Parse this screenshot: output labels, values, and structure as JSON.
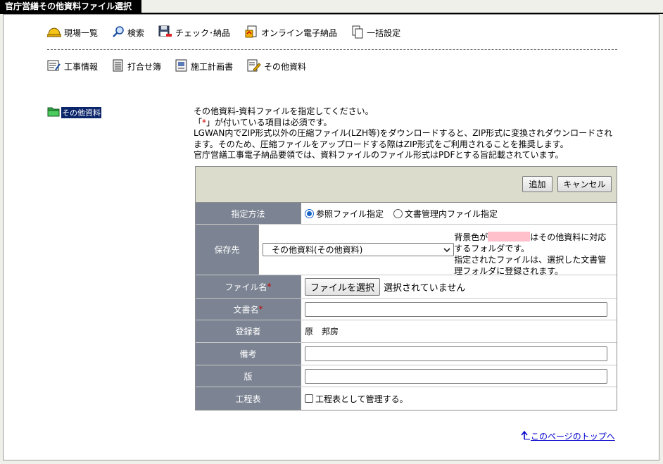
{
  "window": {
    "title": "官庁営繕その他資料ファイル選択"
  },
  "toolbar1": [
    {
      "label": "現場一覧",
      "icon": "hardhat-icon"
    },
    {
      "label": "検索",
      "icon": "magnifier-icon"
    },
    {
      "label": "チェック･納品",
      "icon": "floppy-disk-icon"
    },
    {
      "label": "オンライン電子納品",
      "icon": "online-delivery-icon"
    },
    {
      "label": "一括設定",
      "icon": "copy-pages-icon"
    }
  ],
  "toolbar2": [
    {
      "label": "工事情報",
      "icon": "construction-info-icon"
    },
    {
      "label": "打合せ簿",
      "icon": "meeting-record-icon"
    },
    {
      "label": "施工計画書",
      "icon": "construction-plan-icon"
    },
    {
      "label": "その他資料",
      "icon": "other-docs-icon"
    }
  ],
  "tree": {
    "selected_label": "その他資料"
  },
  "notes": {
    "line1": "その他資料-資料ファイルを指定してください。",
    "line2_pre": "「",
    "line2_star": "*",
    "line2_post": "」が付いている項目は必須です。",
    "line3": "LGWAN内でZIP形式以外の圧縮ファイル(LZH等)をダウンロードすると、ZIP形式に変換されダウンロードされます。そのため、圧縮ファイルをアップロードする際はZIP形式をご利用されることを推奨します。",
    "line4": "官庁営繕工事電子納品要領では、資料ファイルのファイル形式はPDFとする旨記載されています。"
  },
  "buttons": {
    "add": "追加",
    "cancel": "キャンセル"
  },
  "form": {
    "method": {
      "label": "指定方法",
      "option1": "参照ファイル指定",
      "option2": "文書管理内ファイル指定",
      "selected": "参照ファイル指定"
    },
    "destination": {
      "label": "保存先",
      "selected": "その他資料(その他資料)",
      "note_pre": "背景色が",
      "note_post": "はその他資料に対応するフォルダです。",
      "note2": "指定されたファイルは、選択した文書管理フォルダに登録されます。",
      "highlight_color": "#ffc0cb"
    },
    "file": {
      "label": "ファイル名",
      "star": "*",
      "button": "ファイルを選択",
      "status": "選択されていません"
    },
    "doc_name": {
      "label": "文書名",
      "star": "*",
      "value": ""
    },
    "registrant": {
      "label": "登録者",
      "value": "原　邦房"
    },
    "remarks": {
      "label": "備考",
      "value": ""
    },
    "version": {
      "label": "版",
      "value": ""
    },
    "schedule": {
      "label": "工程表",
      "checkbox_label": "工程表として管理する。",
      "checked": false
    }
  },
  "top_link": {
    "label": "このページのトップへ"
  }
}
